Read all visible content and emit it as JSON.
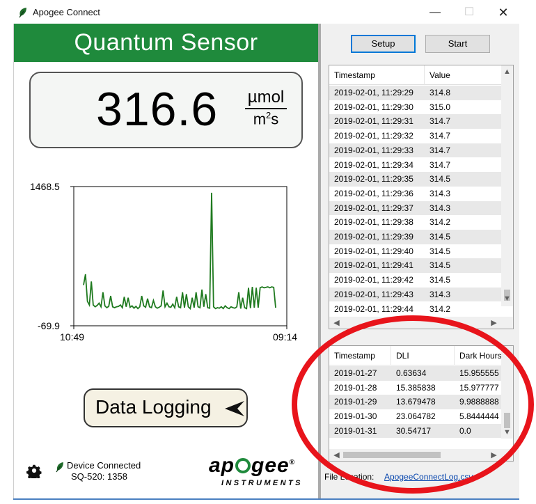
{
  "window": {
    "title": "Apogee Connect",
    "minimize_glyph": "—",
    "maximize_glyph": "☐",
    "close_glyph": "✕"
  },
  "sensor": {
    "name": "Quantum Sensor",
    "value": "316.6",
    "unit_numerator": "µmol",
    "unit_denominator": "m",
    "unit_exponent": "2",
    "unit_denominator_tail": "s"
  },
  "chart_data": {
    "type": "line",
    "y_max_label": "1468.5",
    "y_min_label": "-69.9",
    "ylim": [
      -69.9,
      1468.5
    ],
    "x_start_label": "10:49",
    "x_end_label": "09:14",
    "series_color": "#1f7a1f",
    "y": [
      380,
      500,
      200,
      160,
      420,
      160,
      140,
      155,
      180,
      140,
      300,
      150,
      130,
      145,
      260,
      140,
      130,
      140,
      145,
      160,
      130,
      250,
      140,
      240,
      135,
      150,
      125,
      145,
      120,
      140,
      260,
      150,
      135,
      230,
      140,
      130,
      210,
      140,
      125,
      135,
      150,
      320,
      140,
      180,
      140,
      135,
      170,
      130,
      250,
      140,
      130,
      300,
      130,
      280,
      140,
      120,
      240,
      130,
      300,
      140,
      130,
      330,
      140,
      280,
      130,
      125,
      1400,
      140,
      120,
      130,
      125,
      140,
      120,
      150,
      130,
      120,
      140,
      130,
      125,
      140,
      300,
      120,
      240,
      130,
      120,
      350,
      125,
      360,
      130,
      350,
      130,
      350,
      360,
      350,
      355,
      360,
      350,
      360,
      355,
      130
    ]
  },
  "logging": {
    "label": "Data Logging",
    "arrow_icon": "send-arrow-icon"
  },
  "device": {
    "status": "Device Connected",
    "model": "SQ-520: 1358"
  },
  "brand": {
    "name_start": "ap",
    "name_end": "gee",
    "registered": "®",
    "tagline": "INSTRUMENTS"
  },
  "buttons": {
    "setup": "Setup",
    "start": "Start"
  },
  "readings_table": {
    "columns": [
      "Timestamp",
      "Value"
    ],
    "rows": [
      [
        "2019-02-01, 11:29:29",
        "314.8"
      ],
      [
        "2019-02-01, 11:29:30",
        "315.0"
      ],
      [
        "2019-02-01, 11:29:31",
        "314.7"
      ],
      [
        "2019-02-01, 11:29:32",
        "314.7"
      ],
      [
        "2019-02-01, 11:29:33",
        "314.7"
      ],
      [
        "2019-02-01, 11:29:34",
        "314.7"
      ],
      [
        "2019-02-01, 11:29:35",
        "314.5"
      ],
      [
        "2019-02-01, 11:29:36",
        "314.3"
      ],
      [
        "2019-02-01, 11:29:37",
        "314.3"
      ],
      [
        "2019-02-01, 11:29:38",
        "314.2"
      ],
      [
        "2019-02-01, 11:29:39",
        "314.5"
      ],
      [
        "2019-02-01, 11:29:40",
        "314.5"
      ],
      [
        "2019-02-01, 11:29:41",
        "314.5"
      ],
      [
        "2019-02-01, 11:29:42",
        "314.5"
      ],
      [
        "2019-02-01, 11:29:43",
        "314.3"
      ],
      [
        "2019-02-01, 11:29:44",
        "314.2"
      ]
    ]
  },
  "daily_table": {
    "columns": [
      "Timestamp",
      "DLI",
      "Dark Hours"
    ],
    "rows": [
      [
        "2019-01-27",
        "0.63634",
        "15.955555"
      ],
      [
        "2019-01-28",
        "15.385838",
        "15.977777"
      ],
      [
        "2019-01-29",
        "13.679478",
        "9.9888888"
      ],
      [
        "2019-01-30",
        "23.064782",
        "5.8444444"
      ],
      [
        "2019-01-31",
        "30.54717",
        "0.0"
      ]
    ]
  },
  "file": {
    "label": "File Location:",
    "path": "ApogeeConnectLog.csv"
  },
  "colors": {
    "header_green": "#1f8a3c",
    "highlight_red": "#e8141b",
    "link_blue": "#0645ad"
  }
}
